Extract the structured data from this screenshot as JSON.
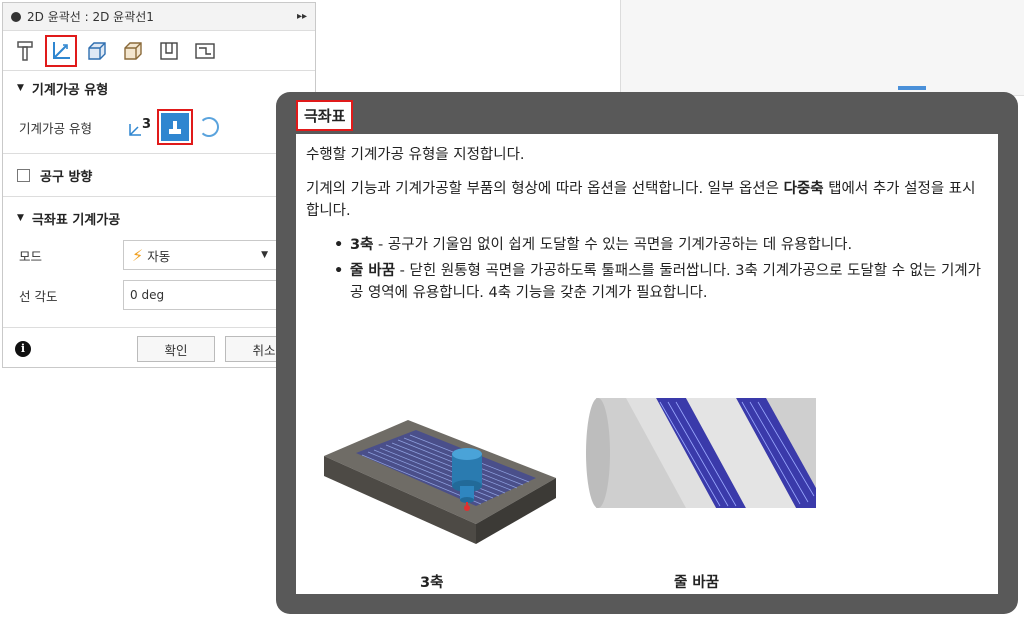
{
  "dialog": {
    "title": "2D 윤곽선 : 2D 윤곽선1",
    "tabs": [
      {
        "name": "tool-tab",
        "icon": "tool-icon"
      },
      {
        "name": "geometry-tab",
        "icon": "axis-icon"
      },
      {
        "name": "heights-tab",
        "icon": "box-icon"
      },
      {
        "name": "passes-tab",
        "icon": "stock-icon"
      },
      {
        "name": "linking-tab",
        "icon": "linking-icon"
      },
      {
        "name": "feed-tab",
        "icon": "path-icon"
      }
    ],
    "section_machining_type": "기계가공 유형",
    "machining_type_label": "기계가공 유형",
    "type_3axis_sup": "3",
    "section_tool_orientation": "공구 방향",
    "section_polar": "극좌표 기계가공",
    "mode_label": "모드",
    "mode_value": "자동",
    "line_angle_label": "선 각도",
    "line_angle_value": "0 deg",
    "ok_button": "확인",
    "cancel_button": "취소"
  },
  "tooltip": {
    "title": "극좌표",
    "para1": "수행할 기계가공 유형을 지정합니다.",
    "para2_before": "기계의 기능과 기계가공할 부품의 형상에 따라 옵션을 선택합니다. 일부 옵션은 ",
    "para2_bold": "다중축",
    "para2_after": " 탭에서 추가 설정을 표시합니다.",
    "bullets": [
      {
        "bold": "3축",
        "text": " - 공구가 기울임 없이 쉽게 도달할 수 있는 곡면을 기계가공하는 데 유용합니다."
      },
      {
        "bold": "줄 바꿈",
        "text": " - 닫힌 원통형 곡면을 가공하도록 툴패스를 둘러쌉니다. 3축 기계가공으로 도달할 수 없는 기계가공 영역에 유용합니다. 4축 기능을 갖춘 기계가 필요합니다."
      }
    ],
    "caption_3axis": "3축",
    "caption_wrap": "줄 바꿈"
  },
  "colors": {
    "highlight": "#e01a1a",
    "accent_blue": "#2f86d0",
    "tooltip_frame": "#595959"
  }
}
